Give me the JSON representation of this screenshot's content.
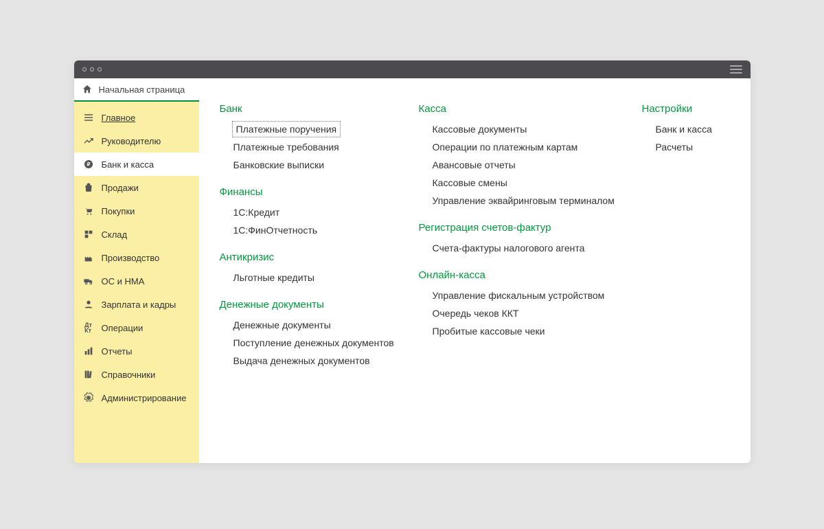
{
  "tab": {
    "home_label": "Начальная страница"
  },
  "sidebar": {
    "items": [
      {
        "label": "Главное",
        "icon": "menu"
      },
      {
        "label": "Руководителю",
        "icon": "trend"
      },
      {
        "label": "Банк и касса",
        "icon": "ruble"
      },
      {
        "label": "Продажи",
        "icon": "bag"
      },
      {
        "label": "Покупки",
        "icon": "cart"
      },
      {
        "label": "Склад",
        "icon": "boxes"
      },
      {
        "label": "Производство",
        "icon": "factory"
      },
      {
        "label": "ОС и НМА",
        "icon": "truck"
      },
      {
        "label": "Зарплата и кадры",
        "icon": "person"
      },
      {
        "label": "Операции",
        "icon": "dtkt"
      },
      {
        "label": "Отчеты",
        "icon": "bars"
      },
      {
        "label": "Справочники",
        "icon": "books"
      },
      {
        "label": "Администрирование",
        "icon": "gear"
      }
    ]
  },
  "content": {
    "col1": [
      {
        "title": "Банк",
        "links": [
          "Платежные поручения",
          "Платежные требования",
          "Банковские выписки"
        ]
      },
      {
        "title": "Финансы",
        "links": [
          "1С:Кредит",
          "1С:ФинОтчетность"
        ]
      },
      {
        "title": "Антикризис",
        "links": [
          "Льготные кредиты"
        ]
      },
      {
        "title": "Денежные документы",
        "links": [
          "Денежные документы",
          "Поступление денежных документов",
          "Выдача денежных документов"
        ]
      }
    ],
    "col2": [
      {
        "title": "Касса",
        "links": [
          "Кассовые документы",
          "Операции по платежным картам",
          "Авансовые отчеты",
          "Кассовые смены",
          "Управление эквайринговым терминалом"
        ]
      },
      {
        "title": "Регистрация счетов-фактур",
        "links": [
          "Счета-фактуры налогового агента"
        ]
      },
      {
        "title": "Онлайн-касса",
        "links": [
          "Управление фискальным устройством",
          "Очередь чеков ККТ",
          "Пробитые кассовые чеки"
        ]
      }
    ],
    "col3": [
      {
        "title": "Настройки",
        "links": [
          "Банк и касса",
          "Расчеты"
        ]
      }
    ]
  }
}
